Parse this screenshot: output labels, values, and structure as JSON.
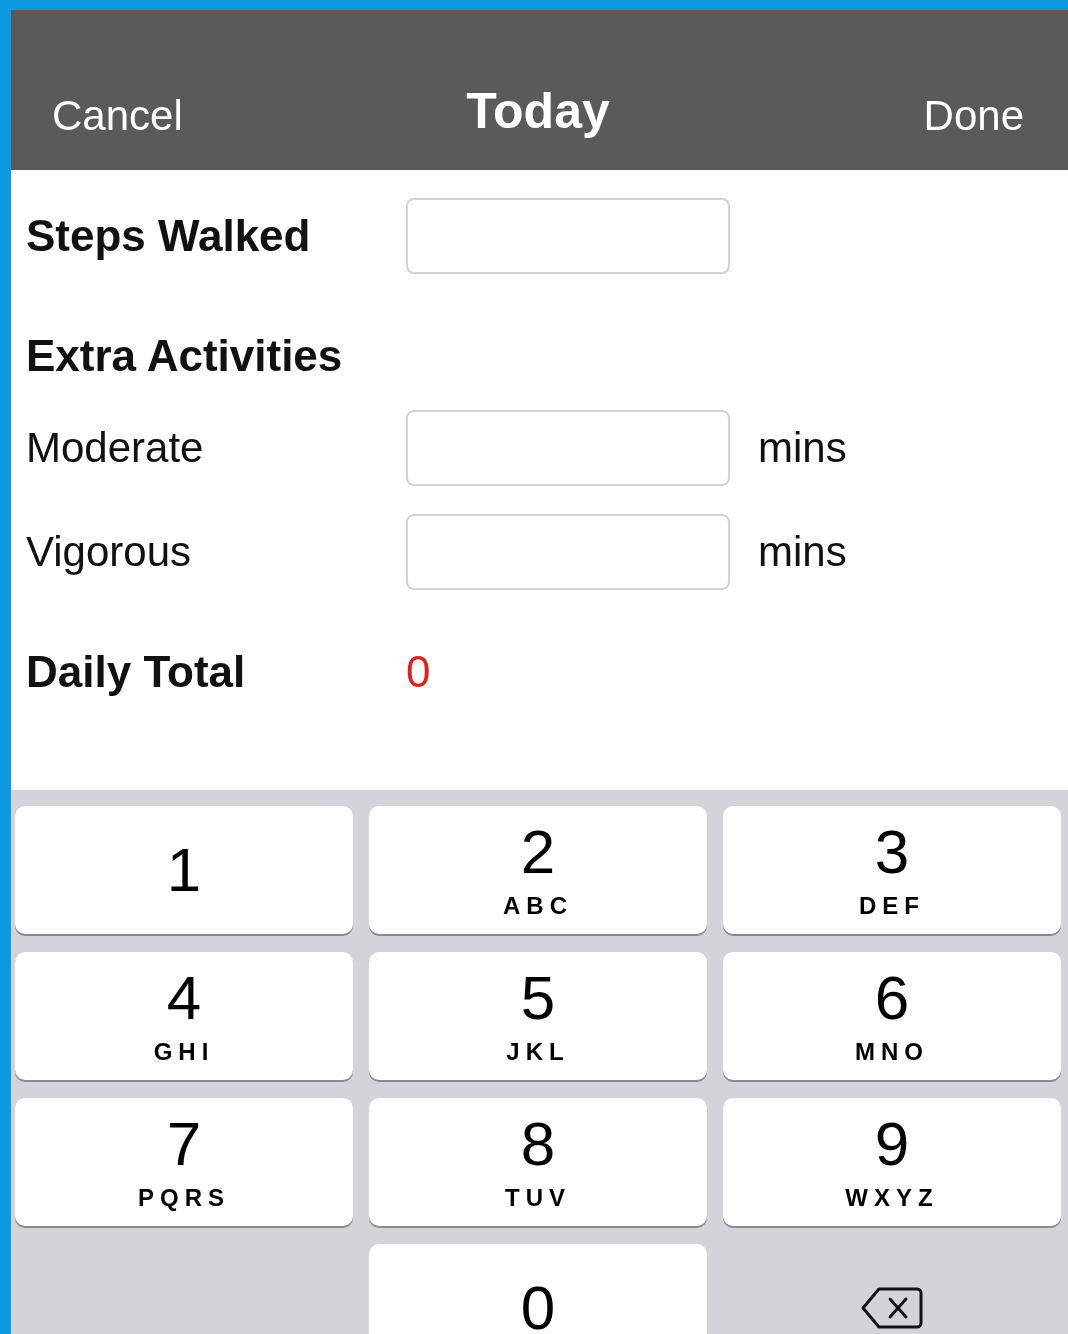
{
  "header": {
    "cancel": "Cancel",
    "title": "Today",
    "done": "Done"
  },
  "steps": {
    "label": "Steps Walked"
  },
  "extra_activities": {
    "heading": "Extra Activities",
    "rows": [
      {
        "label": "Moderate",
        "unit": "mins"
      },
      {
        "label": "Vigorous",
        "unit": "mins"
      }
    ]
  },
  "daily_total": {
    "label": "Daily Total",
    "value": "0"
  },
  "keypad": {
    "keys": [
      {
        "kind": "digit",
        "digit": "1"
      },
      {
        "kind": "digit",
        "digit": "2",
        "letters": "ABC"
      },
      {
        "kind": "digit",
        "digit": "3",
        "letters": "DEF"
      },
      {
        "kind": "digit",
        "digit": "4",
        "letters": "GHI"
      },
      {
        "kind": "digit",
        "digit": "5",
        "letters": "JKL"
      },
      {
        "kind": "digit",
        "digit": "6",
        "letters": "MNO"
      },
      {
        "kind": "digit",
        "digit": "7",
        "letters": "PQRS"
      },
      {
        "kind": "digit",
        "digit": "8",
        "letters": "TUV"
      },
      {
        "kind": "digit",
        "digit": "9",
        "letters": "WXYZ"
      },
      {
        "kind": "blank"
      },
      {
        "kind": "digit",
        "digit": "0"
      },
      {
        "kind": "delete"
      }
    ]
  }
}
